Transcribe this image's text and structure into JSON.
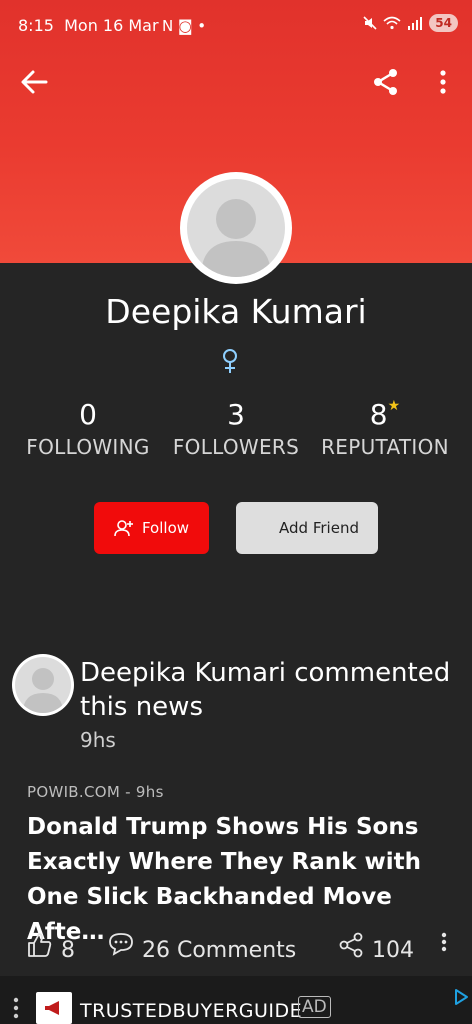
{
  "status_bar": {
    "time": "8:15",
    "date": "Mon 16 Mar",
    "icons_left": "N ◙ •",
    "battery": "54"
  },
  "toolbar": {
    "back_icon": "arrow-left-icon",
    "share_icon": "share-icon",
    "more_icon": "more-vertical-icon"
  },
  "profile": {
    "name": "Deepika Kumari",
    "gender_icon": "female-icon",
    "stats": [
      {
        "value": "0",
        "label": "FOLLOWING"
      },
      {
        "value": "3",
        "label": "FOLLOWERS"
      },
      {
        "value": "8",
        "label": "REPUTATION"
      }
    ],
    "follow_label": "Follow",
    "add_friend_label": "Add Friend"
  },
  "activity": {
    "text": "Deepika Kumari commented this news",
    "time": "9hs",
    "source": "POWIB.COM - 9hs",
    "headline": "Donald Trump Shows His Sons Exactly Where They Rank with One Slick Backhanded Move Afte…",
    "likes": "8",
    "comments": "26 Comments",
    "shares": "104"
  },
  "ad": {
    "advertiser": "TRUSTEDBUYERGUIDE",
    "badge": "AD"
  },
  "colors": {
    "header_red": "#e1322c",
    "follow_red": "#f10b0b",
    "background": "#252525",
    "star": "#f5c518"
  }
}
